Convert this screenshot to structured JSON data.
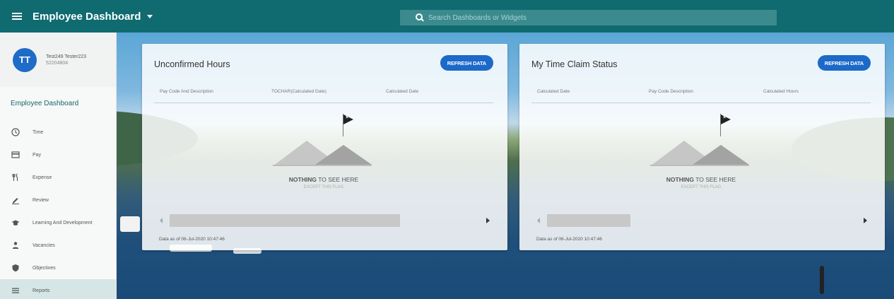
{
  "header": {
    "app_title": "Employee Dashboard",
    "search_placeholder": "Search Dashboards or Widgets",
    "color": "#0f6b70"
  },
  "sidebar": {
    "profile": {
      "initials": "TT",
      "name": "Test249 Tester223",
      "id": "52204804",
      "avatar_color": "#1e6cc7"
    },
    "dashboard_link": "Employee Dashboard",
    "items": [
      {
        "label": "Time",
        "icon": "clock-icon"
      },
      {
        "label": "Pay",
        "icon": "card-icon"
      },
      {
        "label": "Expense",
        "icon": "cutlery-icon"
      },
      {
        "label": "Review",
        "icon": "pencil-icon"
      },
      {
        "label": "Learning And Development",
        "icon": "graduation-cap-icon"
      },
      {
        "label": "Vacancies",
        "icon": "person-icon"
      },
      {
        "label": "Objectives",
        "icon": "shield-icon"
      },
      {
        "label": "Reports",
        "icon": "list-icon",
        "active": true
      }
    ]
  },
  "cards": [
    {
      "title": "Unconfirmed Hours",
      "refresh_label": "REFRESH DATA",
      "columns": [
        "Pay Code And Description",
        "TOCHAR(Calculated Date)",
        "Calculated Date"
      ],
      "empty_title_bold": "NOTHING",
      "empty_title_rest": " TO SEE HERE",
      "empty_subtitle": "EXCEPT THIS FLAG",
      "footer": "Data as of 06-Jul-2020 10:47:46"
    },
    {
      "title": "My Time Claim Status",
      "refresh_label": "REFRESH DATA",
      "columns": [
        "Calculated Date",
        "Pay Code Description",
        "Calculated Hours"
      ],
      "empty_title_bold": "NOTHING",
      "empty_title_rest": " TO SEE HERE",
      "empty_subtitle": "EXCEPT THIS FLAG",
      "footer": "Data as of 06-Jul-2020 10:47:46"
    }
  ],
  "accent_color": "#1c69c9"
}
